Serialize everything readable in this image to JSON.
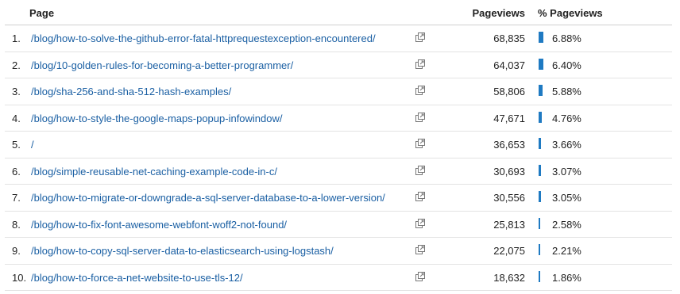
{
  "table": {
    "headers": {
      "page": "Page",
      "pageviews": "Pageviews",
      "pct_pageviews": "% Pageviews"
    },
    "rows": [
      {
        "rank": "1.",
        "page": "/blog/how-to-solve-the-github-error-fatal-httprequestexception-encountered/",
        "pageviews": "68,835",
        "pct": "6.88%",
        "pct_value": 6.88
      },
      {
        "rank": "2.",
        "page": "/blog/10-golden-rules-for-becoming-a-better-programmer/",
        "pageviews": "64,037",
        "pct": "6.40%",
        "pct_value": 6.4
      },
      {
        "rank": "3.",
        "page": "/blog/sha-256-and-sha-512-hash-examples/",
        "pageviews": "58,806",
        "pct": "5.88%",
        "pct_value": 5.88
      },
      {
        "rank": "4.",
        "page": "/blog/how-to-style-the-google-maps-popup-infowindow/",
        "pageviews": "47,671",
        "pct": "4.76%",
        "pct_value": 4.76
      },
      {
        "rank": "5.",
        "page": "/",
        "pageviews": "36,653",
        "pct": "3.66%",
        "pct_value": 3.66
      },
      {
        "rank": "6.",
        "page": "/blog/simple-reusable-net-caching-example-code-in-c/",
        "pageviews": "30,693",
        "pct": "3.07%",
        "pct_value": 3.07
      },
      {
        "rank": "7.",
        "page": "/blog/how-to-migrate-or-downgrade-a-sql-server-database-to-a-lower-version/",
        "pageviews": "30,556",
        "pct": "3.05%",
        "pct_value": 3.05
      },
      {
        "rank": "8.",
        "page": "/blog/how-to-fix-font-awesome-webfont-woff2-not-found/",
        "pageviews": "25,813",
        "pct": "2.58%",
        "pct_value": 2.58
      },
      {
        "rank": "9.",
        "page": "/blog/how-to-copy-sql-server-data-to-elasticsearch-using-logstash/",
        "pageviews": "22,075",
        "pct": "2.21%",
        "pct_value": 2.21
      },
      {
        "rank": "10.",
        "page": "/blog/how-to-force-a-net-website-to-use-tls-12/",
        "pageviews": "18,632",
        "pct": "1.86%",
        "pct_value": 1.86
      }
    ],
    "icons": {
      "row_action": "open-in-new-window-icon"
    },
    "colors": {
      "link": "#1a5fa3",
      "bar": "#1f7ac2"
    }
  }
}
